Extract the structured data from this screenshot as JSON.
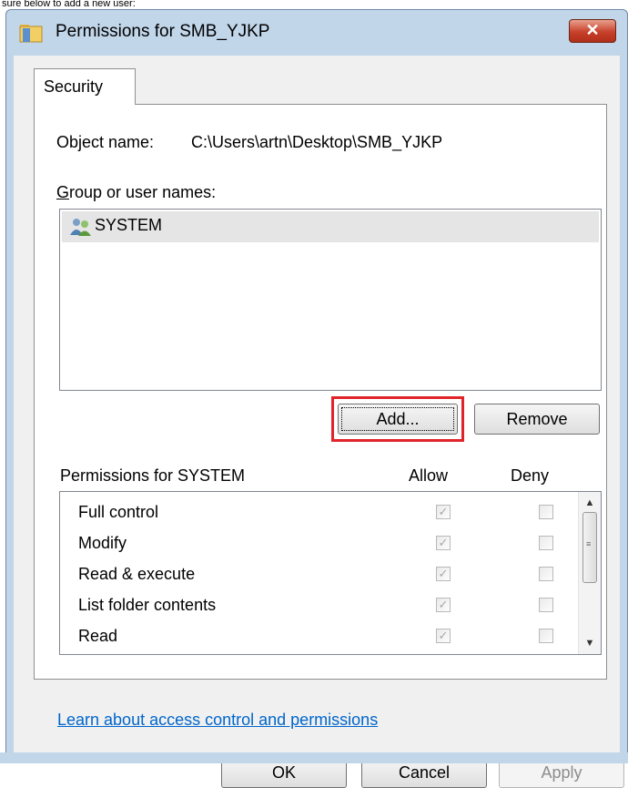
{
  "caption": "sure below to add a new user:",
  "window": {
    "title": "Permissions for SMB_YJKP",
    "close_label": "✕"
  },
  "tabs": [
    {
      "label": "Security"
    }
  ],
  "object": {
    "label": "Object name:",
    "value": "C:\\Users\\artn\\Desktop\\SMB_YJKP"
  },
  "group_label": "Group or user names:",
  "users": [
    {
      "name": "SYSTEM",
      "selected": true
    }
  ],
  "buttons": {
    "add": "Add...",
    "remove": "Remove",
    "ok": "OK",
    "cancel": "Cancel",
    "apply": "Apply"
  },
  "permissions": {
    "header": "Permissions for SYSTEM",
    "allow_label": "Allow",
    "deny_label": "Deny",
    "rows": [
      {
        "name": "Full control",
        "allow": true,
        "deny": false
      },
      {
        "name": "Modify",
        "allow": true,
        "deny": false
      },
      {
        "name": "Read & execute",
        "allow": true,
        "deny": false
      },
      {
        "name": "List folder contents",
        "allow": true,
        "deny": false
      },
      {
        "name": "Read",
        "allow": true,
        "deny": false
      }
    ]
  },
  "link": "Learn about access control and permissions",
  "colors": {
    "highlight": "#e0242a",
    "link": "#0066cc",
    "close_button": "#c7402a"
  }
}
